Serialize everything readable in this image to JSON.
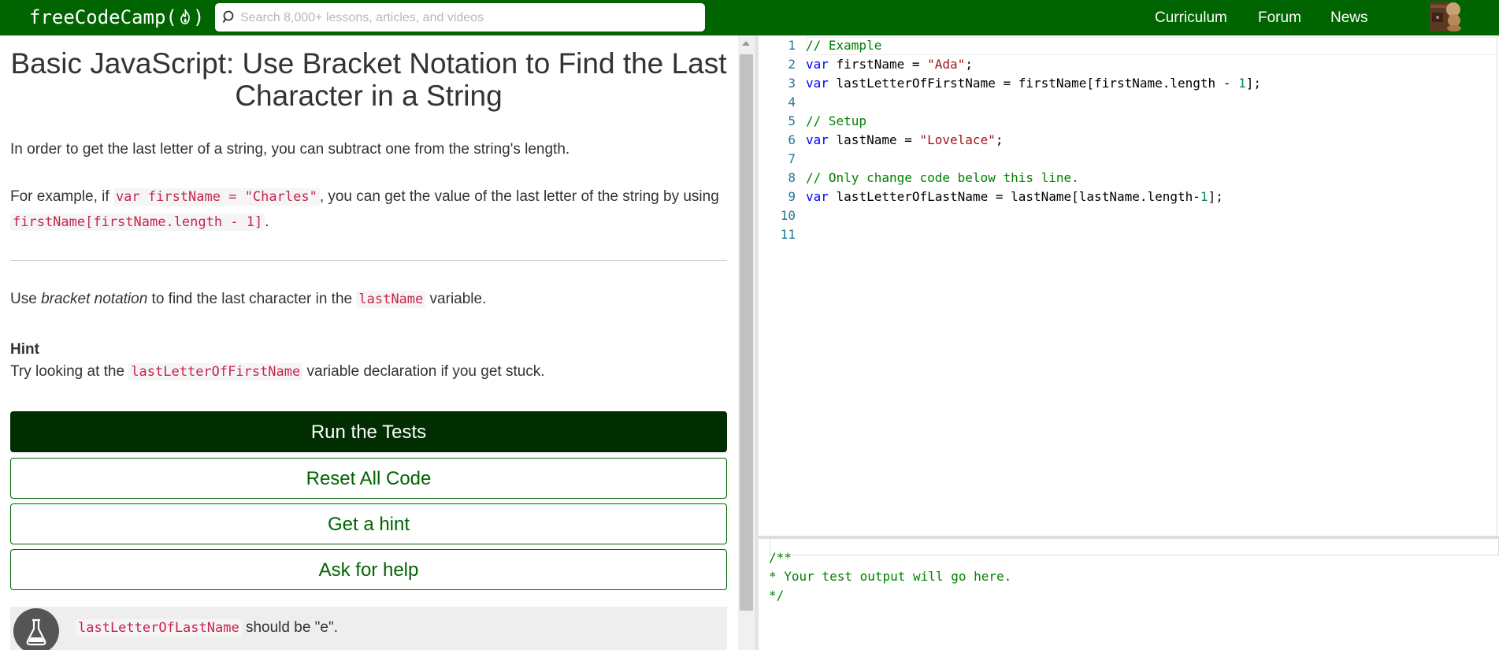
{
  "navbar": {
    "logo_text": "freeCodeCamp",
    "search_placeholder": "Search 8,000+ lessons, articles, and videos",
    "links": [
      "Curriculum",
      "Forum",
      "News"
    ]
  },
  "challenge": {
    "title": "Basic JavaScript: Use Bracket Notation to Find the Last Character in a String",
    "para1": "In order to get the last letter of a string, you can subtract one from the string's length.",
    "para2": {
      "t1": "For example, if ",
      "code1": "var firstName = \"Charles\"",
      "t2": ", you can get the value of the last letter of the string by using ",
      "code2": "firstName[firstName.length - 1]",
      "t3": "."
    },
    "instruction": {
      "t1": "Use ",
      "em": "bracket notation",
      "t2": " to find the last character in the ",
      "code": "lastName",
      "t3": " variable."
    },
    "hint_title": "Hint",
    "hint": {
      "t1": "Try looking at the ",
      "code": "lastLetterOfFirstName",
      "t2": " variable declaration if you get stuck."
    }
  },
  "buttons": {
    "run": "Run the Tests",
    "reset": "Reset All Code",
    "hint": "Get a hint",
    "help": "Ask for help"
  },
  "tests": [
    {
      "code": "lastLetterOfLastName",
      "text": " should be \"e\"."
    }
  ],
  "editor": {
    "line_numbers": [
      "1",
      "2",
      "3",
      "4",
      "5",
      "6",
      "7",
      "8",
      "9",
      "10",
      "11"
    ],
    "lines": [
      "// Example",
      "var firstName = \"Ada\";",
      "var lastLetterOfFirstName = firstName[firstName.length - 1];",
      "",
      "// Setup",
      "var lastName = \"Lovelace\";",
      "",
      "// Only change code below this line.",
      "var lastLetterOfLastName = lastName[lastName.length-1];",
      "",
      ""
    ]
  },
  "output": {
    "lines": [
      "/**",
      "* Your test output will go here.",
      "*/"
    ]
  },
  "colors": {
    "brand_green": "#006400",
    "run_button_bg": "#002e00",
    "inline_code": "#c7254e",
    "comment": "#008000",
    "keyword": "#0000ff",
    "string": "#a31515"
  },
  "icons": [
    "fire-icon",
    "search-icon",
    "avatar",
    "flask-icon"
  ]
}
